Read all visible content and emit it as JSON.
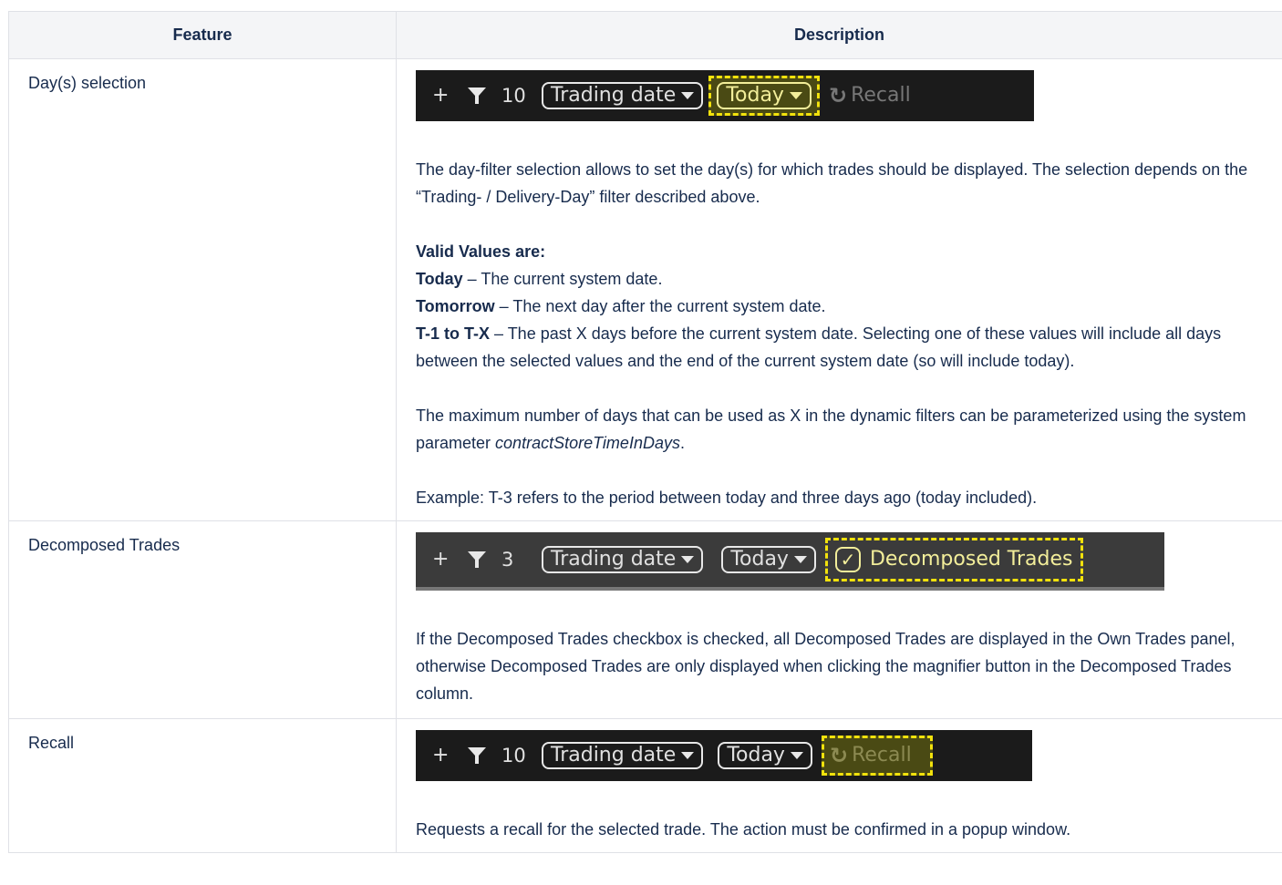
{
  "table": {
    "headers": {
      "feature": "Feature",
      "description": "Description"
    }
  },
  "rows": [
    {
      "feature": "Day(s) selection",
      "toolbar": {
        "plus": "+",
        "count": "10",
        "trading_date": "Trading date",
        "today": "Today",
        "recall": "Recall"
      },
      "p1": "The day-filter selection allows to set the day(s) for which trades should be displayed. The selection depends on the “Trading- / Delivery-Day” filter described above.",
      "valid_heading": "Valid Values are:",
      "v_today_b": "Today",
      "v_today_t": " – The current system date.",
      "v_tomorrow_b": "Tomorrow",
      "v_tomorrow_t": " – The next day after the current system date.",
      "v_t1_b": "T-1 to T-X",
      "v_t1_t": " – The past X days before the current system date. Selecting one of these values will include all days between the selected values and the end of the current system date (so will include today).",
      "max_a": "The maximum number of days that can be used as X in the dynamic filters can be parameterized using the system parameter ",
      "max_i": "contractStoreTimeInDays",
      "max_b": ".",
      "example": "Example: T-3 refers to the period between today and three days ago (today included)."
    },
    {
      "feature": "Decomposed Trades",
      "toolbar": {
        "plus": "+",
        "count": "3",
        "trading_date": "Trading date",
        "today": "Today",
        "decomposed": "Decomposed Trades"
      },
      "p1": "If the Decomposed Trades checkbox is checked, all Decomposed Trades are displayed in the Own Trades panel, otherwise Decomposed Trades are only displayed when clicking the magnifier button in the Decomposed Trades column."
    },
    {
      "feature": "Recall",
      "toolbar": {
        "plus": "+",
        "count": "10",
        "trading_date": "Trading date",
        "today": "Today",
        "recall": "Recall"
      },
      "p1": "Requests a recall for the selected trade. The action must be confirmed in a popup window."
    }
  ],
  "colors": {
    "highlight": "#f2e20c",
    "toolbar_bg": "#1b1b1b",
    "header_bg": "#f4f5f7"
  },
  "icons": [
    "plus-icon",
    "filter-icon",
    "caret-down-icon",
    "recall-icon",
    "checkbox-icon"
  ]
}
